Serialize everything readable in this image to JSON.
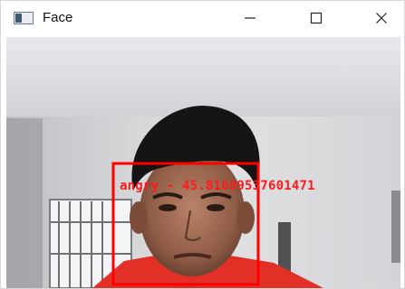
{
  "window": {
    "title": "Face",
    "controls": {
      "minimize": "minimize-icon",
      "maximize": "maximize-icon",
      "close": "close-icon"
    }
  },
  "detection": {
    "label": "angry - 45.81609537601471",
    "box_color": "#ff0000"
  },
  "colors": {
    "titlebar_bg": "#ffffff",
    "title_text": "#111111",
    "accent_red": "#ff1a1a"
  }
}
